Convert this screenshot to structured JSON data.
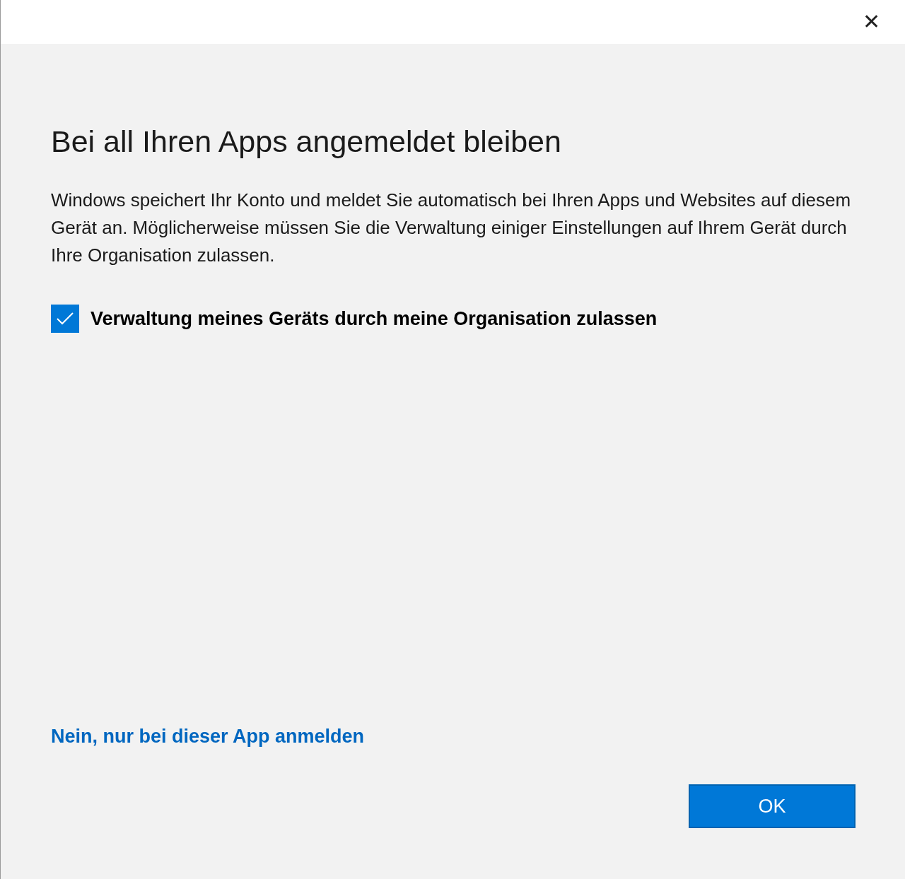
{
  "window": {
    "close": "✕"
  },
  "title": "Bei all Ihren Apps angemeldet bleiben",
  "description": "Windows speichert Ihr Konto und meldet Sie automatisch bei Ihren Apps und Websites auf diesem Gerät an. Möglicherweise müssen Sie die Verwaltung einiger Einstellungen auf Ihrem Gerät durch Ihre Organisation zulassen.",
  "checkbox": {
    "label": "Verwaltung meines Geräts durch meine Organisation zulassen",
    "checked": true
  },
  "link": "Nein, nur bei dieser App anmelden",
  "buttons": [
    "OK"
  ]
}
